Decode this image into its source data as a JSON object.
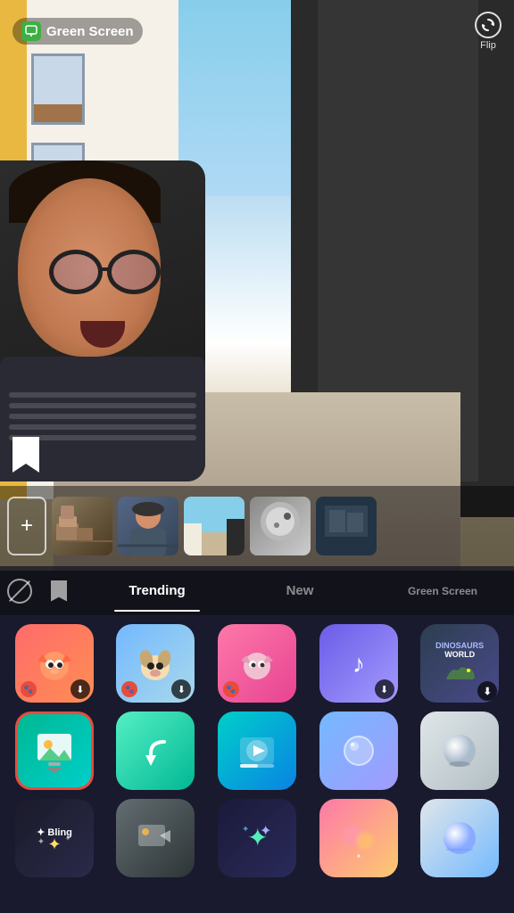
{
  "topBar": {
    "appName": "Green Screen",
    "flipLabel": "Flip"
  },
  "tabs": [
    {
      "id": "block",
      "type": "icon"
    },
    {
      "id": "bookmark",
      "type": "icon"
    },
    {
      "id": "trending",
      "label": "Trending",
      "active": true
    },
    {
      "id": "new",
      "label": "New",
      "active": false
    },
    {
      "id": "greenscreen",
      "label": "Green Screen",
      "active": false
    }
  ],
  "apps": {
    "row1": [
      {
        "id": "app-cat1",
        "colorClass": "app-cat1",
        "emoji": "🐱",
        "hasPaw": true,
        "hasDownload": true
      },
      {
        "id": "app-cat2",
        "colorClass": "app-cat2",
        "emoji": "🐶",
        "hasPaw": true,
        "hasDownload": true
      },
      {
        "id": "app-cat3",
        "colorClass": "app-cat3",
        "emoji": "🐱",
        "hasPaw": true,
        "hasDownload": false
      },
      {
        "id": "app-music",
        "colorClass": "app-music",
        "emoji": "🎵",
        "hasPaw": false,
        "hasDownload": true
      },
      {
        "id": "app-dino",
        "colorClass": "app-dino",
        "label": "DINOSAURS WORLD",
        "hasDownload": true
      }
    ],
    "row2": [
      {
        "id": "app-imgdown",
        "colorClass": "app-imgdown",
        "emoji": "🖼️",
        "hasDownload": false,
        "selected": true
      },
      {
        "id": "app-arrow",
        "colorClass": "app-arrow",
        "emoji": "↩",
        "hasDownload": false
      },
      {
        "id": "app-video",
        "colorClass": "app-video",
        "emoji": "▶",
        "hasDownload": false
      },
      {
        "id": "app-bubble",
        "colorClass": "app-bubble",
        "emoji": "🫧",
        "hasDownload": false
      },
      {
        "id": "app-sphere",
        "colorClass": "app-sphere",
        "emoji": "⚪",
        "hasDownload": false
      }
    ],
    "row3": [
      {
        "id": "app-bling",
        "colorClass": "app-bling",
        "label": "Bling",
        "sparkle": true
      },
      {
        "id": "app-imgfly",
        "colorClass": "app-imgfly",
        "emoji": "🖼️"
      },
      {
        "id": "app-sparkle",
        "colorClass": "app-sparkle",
        "sparkle4": true
      },
      {
        "id": "app-blur",
        "colorClass": "app-blur",
        "emoji": "🌸"
      },
      {
        "id": "app-sphere2",
        "colorClass": "app-sphere2",
        "emoji": "⚪"
      }
    ]
  }
}
